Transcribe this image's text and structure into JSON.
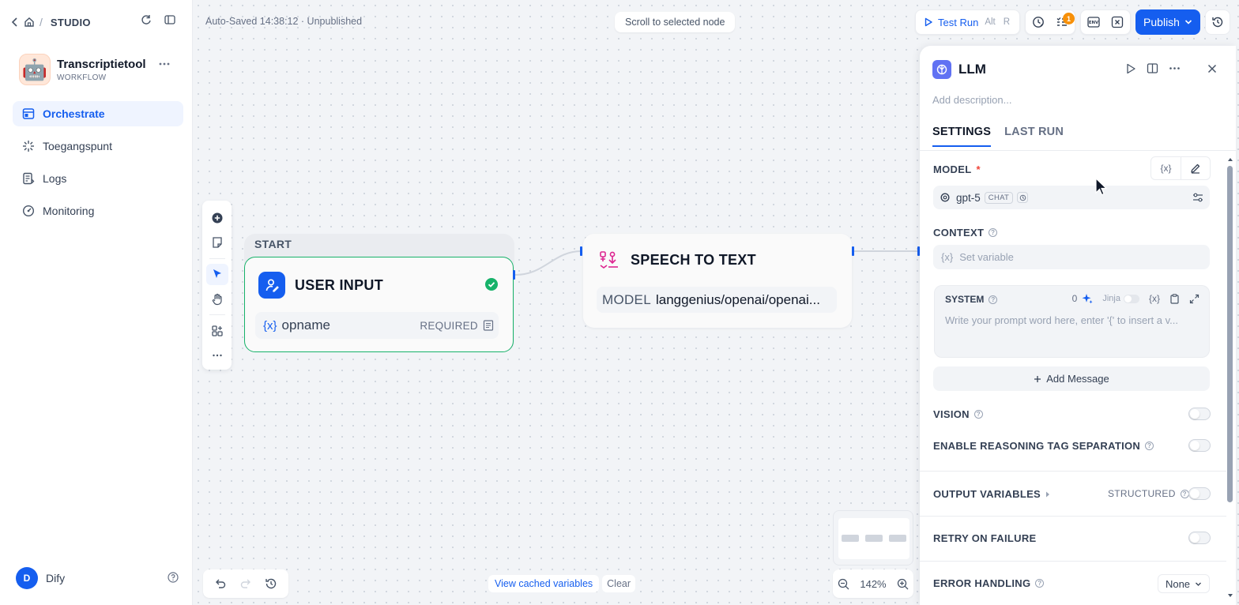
{
  "sidebar": {
    "studio_label": "STUDIO",
    "app": {
      "name": "Transcriptietool",
      "type": "WORKFLOW",
      "icon": "robot-emoji",
      "icon_glyph": "🤖"
    },
    "nav": [
      {
        "label": "Orchestrate",
        "icon": "orchestrate-icon",
        "active": true
      },
      {
        "label": "Toegangspunt",
        "icon": "access-point-icon",
        "active": false
      },
      {
        "label": "Logs",
        "icon": "logs-icon",
        "active": false
      },
      {
        "label": "Monitoring",
        "icon": "monitoring-icon",
        "active": false
      }
    ],
    "user": {
      "initial": "D",
      "name": "Dify"
    }
  },
  "header": {
    "autosave": "Auto-Saved 14:38:12 · Unpublished",
    "scroll_to_node": "Scroll to selected node",
    "test_run": {
      "label": "Test Run",
      "shortcut_1": "Alt",
      "shortcut_2": "R"
    },
    "checklist_badge": "1",
    "env_label": "ENV",
    "publish": "Publish"
  },
  "canvas": {
    "start_label": "START",
    "user_input_node": {
      "title": "USER INPUT",
      "var_prefix": "{x}",
      "var_name": "opname",
      "var_required": "REQUIRED"
    },
    "stt_node": {
      "title": "SPEECH TO TEXT",
      "model_label": "MODEL",
      "model_value": "langgenius/openai/openai..."
    },
    "cached_link": "View cached variables",
    "clear": "Clear",
    "zoom": "142%"
  },
  "panel": {
    "title": "LLM",
    "description_placeholder": "Add description...",
    "tabs": [
      "SETTINGS",
      "LAST RUN"
    ],
    "model_label": "MODEL",
    "model_required": "*",
    "model_var_btn": "{x}",
    "model_name": "gpt-5",
    "model_chip": "CHAT",
    "context_label": "CONTEXT",
    "context_prefix": "{x}",
    "context_placeholder": "Set variable",
    "system_label": "SYSTEM",
    "system_count": "0",
    "jinja_label": "Jinja",
    "system_var_btn": "{x}",
    "system_placeholder": "Write your prompt word here, enter '{' to insert a v...",
    "add_message": "Add Message",
    "vision_label": "VISION",
    "reasoning_label": "ENABLE REASONING TAG SEPARATION",
    "output_vars_label": "OUTPUT VARIABLES",
    "structured_label": "STRUCTURED",
    "retry_label": "RETRY ON FAILURE",
    "error_label": "ERROR HANDLING",
    "error_value": "None"
  },
  "colors": {
    "accent": "#155eef",
    "success": "#17b26a",
    "stt_accent": "#dd2590",
    "llm": "#6172f3",
    "badge": "#f79009"
  }
}
